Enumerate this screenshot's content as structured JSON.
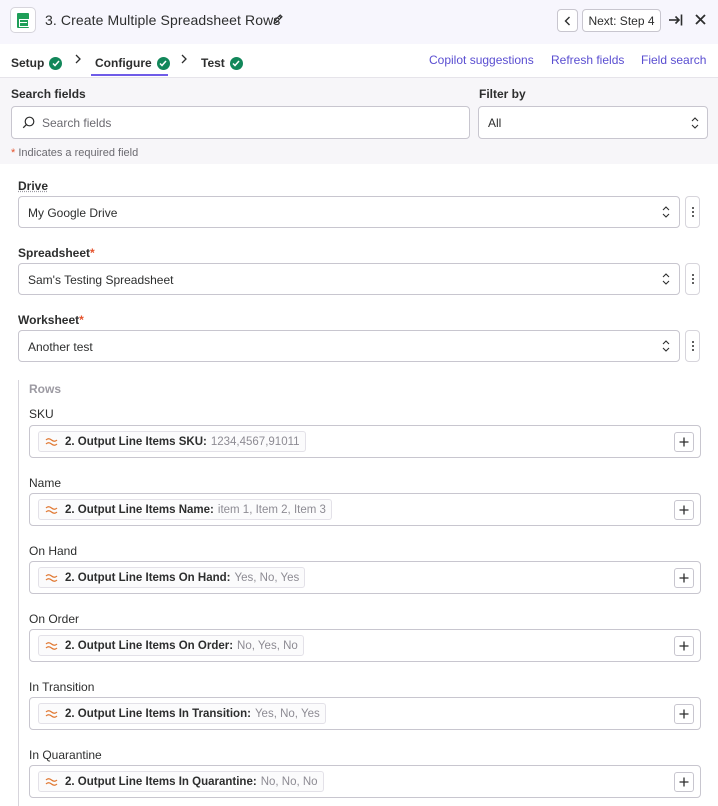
{
  "header": {
    "title": "3. Create Multiple Spreadsheet Rows",
    "next_label": "Next: Step 4"
  },
  "tabs": [
    {
      "label": "Setup",
      "complete": true
    },
    {
      "label": "Configure",
      "complete": true,
      "active": true
    },
    {
      "label": "Test",
      "complete": true
    }
  ],
  "links": {
    "copilot": "Copilot suggestions",
    "refresh": "Refresh fields",
    "field_search": "Field search"
  },
  "filters": {
    "search_label": "Search fields",
    "search_placeholder": "Search fields",
    "filter_label": "Filter by",
    "filter_value": "All",
    "required_star": "*",
    "required_note": "Indicates a required field"
  },
  "fields": {
    "drive": {
      "label": "Drive",
      "value": "My Google Drive",
      "required": false
    },
    "spreadsheet": {
      "label": "Spreadsheet",
      "value": "Sam's Testing Spreadsheet",
      "required": true
    },
    "worksheet": {
      "label": "Worksheet",
      "value": "Another test",
      "required": true
    }
  },
  "rows": {
    "title": "Rows",
    "items": [
      {
        "label": "SKU",
        "token": "2. Output Line Items SKU:",
        "value": "1234,4567,91011"
      },
      {
        "label": "Name",
        "token": "2. Output Line Items Name:",
        "value": "item 1, Item 2, Item 3"
      },
      {
        "label": "On Hand",
        "token": "2. Output Line Items On Hand:",
        "value": "Yes, No, Yes"
      },
      {
        "label": "On Order",
        "token": "2. Output Line Items On Order:",
        "value": "No, Yes, No"
      },
      {
        "label": "In Transition",
        "token": "2. Output Line Items In Transition:",
        "value": "Yes, No, Yes"
      },
      {
        "label": "In Quarantine",
        "token": "2. Output Line Items In Quarantine:",
        "value": "No, No, No"
      }
    ]
  },
  "colors": {
    "accent": "#6f5ce8",
    "link": "#5a4ed1",
    "success": "#12875a",
    "required": "#e5532d",
    "sheets_green": "#1e9e58",
    "token_orange": "#e0762f"
  },
  "icons": {
    "app": "google-sheets-icon",
    "edit": "pencil-icon",
    "prev": "chevron-left-icon",
    "collapse": "collapse-panel-icon",
    "close": "close-icon",
    "search": "search-icon",
    "select": "up-down-chevron-icon",
    "more": "kebab-menu-icon",
    "token": "wave-icon",
    "add": "plus-icon",
    "complete": "check-circle-icon"
  }
}
